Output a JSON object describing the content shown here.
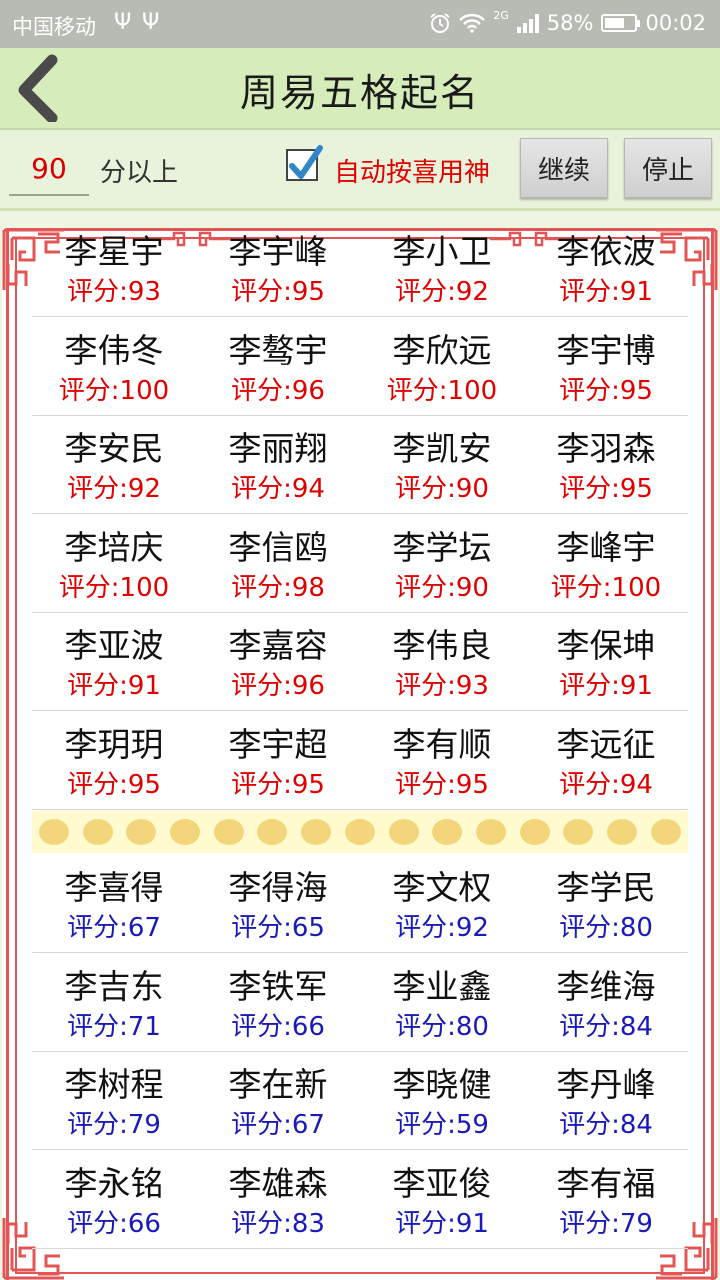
{
  "status_bar": {
    "carrier": "中国移动",
    "usb_icons": [
      "usb-icon",
      "usb-icon"
    ],
    "network": "2G",
    "battery": "58%",
    "time": "00:02"
  },
  "header": {
    "title": "周易五格起名"
  },
  "controls": {
    "score_value": "90",
    "score_suffix": "分以上",
    "auto_label": "自动按喜用神",
    "auto_checked": true,
    "continue_label": "继续",
    "stop_label": "停止"
  },
  "colors": {
    "high_score": "#e00000",
    "low_score": "#1a1ab8",
    "frame": "#e25555",
    "title_bg": "#d6ecbb"
  },
  "high_rows": [
    [
      {
        "name": "李星宇",
        "score": "评分:93"
      },
      {
        "name": "李宇峰",
        "score": "评分:95"
      },
      {
        "name": "李小卫",
        "score": "评分:92"
      },
      {
        "name": "李依波",
        "score": "评分:91"
      }
    ],
    [
      {
        "name": "李伟冬",
        "score": "评分:100"
      },
      {
        "name": "李骜宇",
        "score": "评分:96"
      },
      {
        "name": "李欣远",
        "score": "评分:100"
      },
      {
        "name": "李宇博",
        "score": "评分:95"
      }
    ],
    [
      {
        "name": "李安民",
        "score": "评分:92"
      },
      {
        "name": "李丽翔",
        "score": "评分:94"
      },
      {
        "name": "李凯安",
        "score": "评分:90"
      },
      {
        "name": "李羽森",
        "score": "评分:95"
      }
    ],
    [
      {
        "name": "李培庆",
        "score": "评分:100"
      },
      {
        "name": "李信鸥",
        "score": "评分:98"
      },
      {
        "name": "李学坛",
        "score": "评分:90"
      },
      {
        "name": "李峰宇",
        "score": "评分:100"
      }
    ],
    [
      {
        "name": "李亚波",
        "score": "评分:91"
      },
      {
        "name": "李嘉容",
        "score": "评分:96"
      },
      {
        "name": "李伟良",
        "score": "评分:93"
      },
      {
        "name": "李保坤",
        "score": "评分:91"
      }
    ],
    [
      {
        "name": "李玥玥",
        "score": "评分:95"
      },
      {
        "name": "李宇超",
        "score": "评分:95"
      },
      {
        "name": "李有顺",
        "score": "评分:95"
      },
      {
        "name": "李远征",
        "score": "评分:94"
      }
    ]
  ],
  "low_rows": [
    [
      {
        "name": "李喜得",
        "score": "评分:67"
      },
      {
        "name": "李得海",
        "score": "评分:65"
      },
      {
        "name": "李文权",
        "score": "评分:92"
      },
      {
        "name": "李学民",
        "score": "评分:80"
      }
    ],
    [
      {
        "name": "李吉东",
        "score": "评分:71"
      },
      {
        "name": "李铁军",
        "score": "评分:66"
      },
      {
        "name": "李业鑫",
        "score": "评分:80"
      },
      {
        "name": "李维海",
        "score": "评分:84"
      }
    ],
    [
      {
        "name": "李树程",
        "score": "评分:79"
      },
      {
        "name": "李在新",
        "score": "评分:67"
      },
      {
        "name": "李晓健",
        "score": "评分:59"
      },
      {
        "name": "李丹峰",
        "score": "评分:84"
      }
    ],
    [
      {
        "name": "李永铭",
        "score": "评分:66"
      },
      {
        "name": "李雄森",
        "score": "评分:83"
      },
      {
        "name": "李亚俊",
        "score": "评分:91"
      },
      {
        "name": "李有福",
        "score": "评分:79"
      }
    ]
  ]
}
